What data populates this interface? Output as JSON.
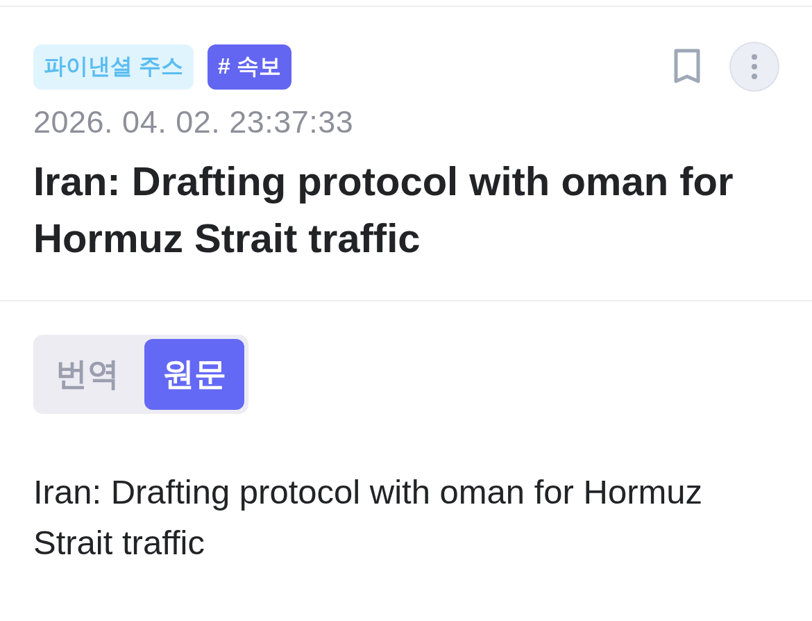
{
  "tags": [
    {
      "label": "파이낸셜 주스",
      "kind": "category"
    },
    {
      "label": "# 속보",
      "kind": "hashtag"
    }
  ],
  "timestamp": "2026. 04. 02. 23:37:33",
  "title": "Iran: Drafting protocol with oman for Hormuz Strait traffic",
  "view_toggle": [
    {
      "label": "번역",
      "selected": false
    },
    {
      "label": "원문",
      "selected": true
    }
  ],
  "body": "Iran: Drafting protocol with oman for Hormuz Strait traffic"
}
